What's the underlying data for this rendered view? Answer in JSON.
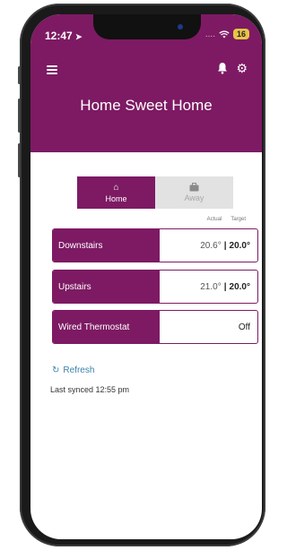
{
  "status": {
    "time": "12:47",
    "signal": "....",
    "battery": "16"
  },
  "app": {
    "title": "Home Sweet Home"
  },
  "mode": {
    "home_label": "Home",
    "away_label": "Away"
  },
  "columns": {
    "actual": "Actual",
    "target": "Target"
  },
  "zones": [
    {
      "name": "Downstairs",
      "actual": "20.6°",
      "target": "20.0°"
    },
    {
      "name": "Upstairs",
      "actual": "21.0°",
      "target": "20.0°"
    },
    {
      "name": "Wired Thermostat",
      "status": "Off"
    }
  ],
  "footer": {
    "refresh_label": "Refresh",
    "last_synced": "Last synced 12:55 pm"
  },
  "colors": {
    "brand": "#7d1a63",
    "link": "#3a82a8"
  },
  "icons": [
    "navigation-arrow-icon",
    "wifi-icon",
    "menu-icon",
    "bell-icon",
    "gear-icon",
    "home-icon",
    "briefcase-icon",
    "refresh-icon"
  ]
}
